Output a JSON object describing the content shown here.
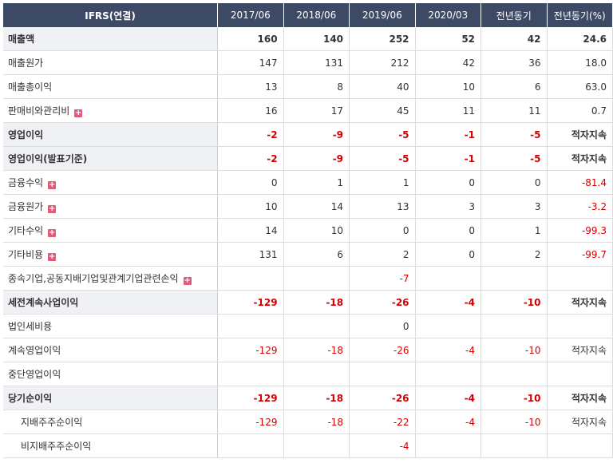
{
  "header": {
    "label": "IFRS(연결)",
    "columns": [
      "2017/06",
      "2018/06",
      "2019/06",
      "2020/03",
      "전년동기",
      "전년동기(%)"
    ]
  },
  "rows": [
    {
      "label": "매출액",
      "values": [
        "160",
        "140",
        "252",
        "52",
        "42",
        "24.6"
      ],
      "bold": true,
      "expand": false
    },
    {
      "label": "매출원가",
      "values": [
        "147",
        "131",
        "212",
        "42",
        "36",
        "18.0"
      ],
      "bold": false,
      "expand": false
    },
    {
      "label": "매출총이익",
      "values": [
        "13",
        "8",
        "40",
        "10",
        "6",
        "63.0"
      ],
      "bold": false,
      "expand": false
    },
    {
      "label": "판매비와관리비",
      "values": [
        "16",
        "17",
        "45",
        "11",
        "11",
        "0.7"
      ],
      "bold": false,
      "expand": true
    },
    {
      "label": "영업이익",
      "values": [
        "-2",
        "-9",
        "-5",
        "-1",
        "-5",
        "적자지속"
      ],
      "bold": true,
      "expand": false
    },
    {
      "label": "영업이익(발표기준)",
      "values": [
        "-2",
        "-9",
        "-5",
        "-1",
        "-5",
        "적자지속"
      ],
      "bold": true,
      "expand": false
    },
    {
      "label": "금융수익",
      "values": [
        "0",
        "1",
        "1",
        "0",
        "0",
        "-81.4"
      ],
      "bold": false,
      "expand": true
    },
    {
      "label": "금융원가",
      "values": [
        "10",
        "14",
        "13",
        "3",
        "3",
        "-3.2"
      ],
      "bold": false,
      "expand": true
    },
    {
      "label": "기타수익",
      "values": [
        "14",
        "10",
        "0",
        "0",
        "1",
        "-99.3"
      ],
      "bold": false,
      "expand": true
    },
    {
      "label": "기타비용",
      "values": [
        "131",
        "6",
        "2",
        "0",
        "2",
        "-99.7"
      ],
      "bold": false,
      "expand": true
    },
    {
      "label": "종속기업,공동지배기업및관계기업관련손익",
      "values": [
        "",
        "",
        "-7",
        "",
        "",
        ""
      ],
      "bold": false,
      "expand": true
    },
    {
      "label": "세전계속사업이익",
      "values": [
        "-129",
        "-18",
        "-26",
        "-4",
        "-10",
        "적자지속"
      ],
      "bold": true,
      "expand": false
    },
    {
      "label": "법인세비용",
      "values": [
        "",
        "",
        "0",
        "",
        "",
        ""
      ],
      "bold": false,
      "expand": false
    },
    {
      "label": "계속영업이익",
      "values": [
        "-129",
        "-18",
        "-26",
        "-4",
        "-10",
        "적자지속"
      ],
      "bold": false,
      "expand": false
    },
    {
      "label": "중단영업이익",
      "values": [
        "",
        "",
        "",
        "",
        "",
        ""
      ],
      "bold": false,
      "expand": false
    },
    {
      "label": "당기순이익",
      "values": [
        "-129",
        "-18",
        "-26",
        "-4",
        "-10",
        "적자지속"
      ],
      "bold": true,
      "expand": false
    },
    {
      "label": "지배주주순이익",
      "values": [
        "-129",
        "-18",
        "-22",
        "-4",
        "-10",
        "적자지속"
      ],
      "bold": false,
      "expand": false,
      "indent": true
    },
    {
      "label": "비지배주주순이익",
      "values": [
        "",
        "",
        "-4",
        "",
        "",
        ""
      ],
      "bold": false,
      "expand": false,
      "indent": true
    }
  ],
  "expand_icon": "plus-icon",
  "colors": {
    "header_bg": "#3c4a66",
    "negative": "#d40000",
    "expand_icon": "#e05a7a"
  }
}
